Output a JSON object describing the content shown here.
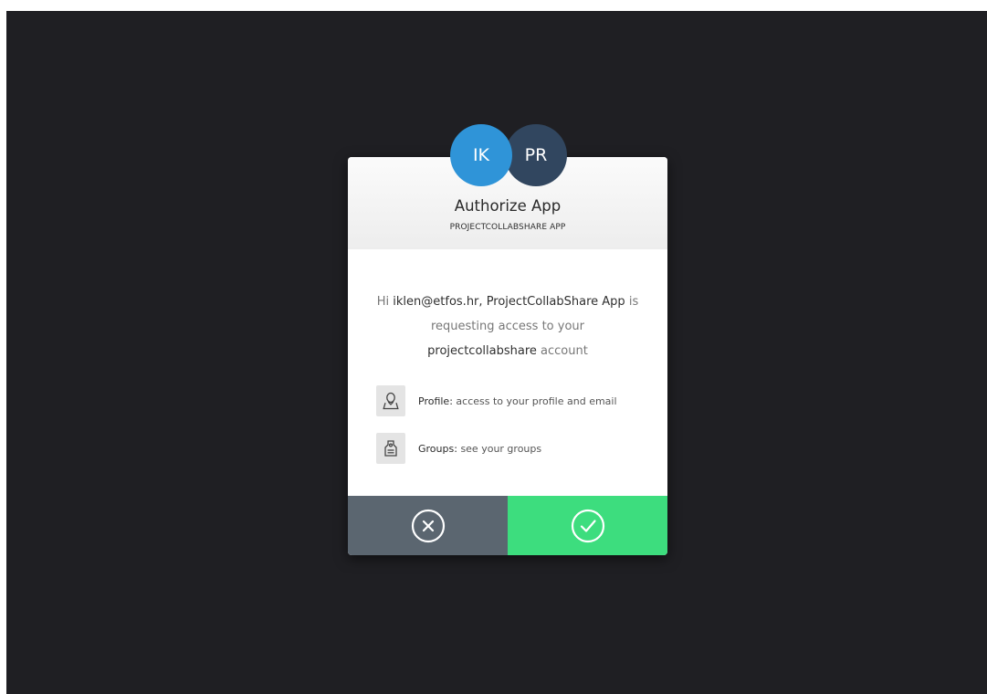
{
  "avatars": {
    "user_initials": "IK",
    "app_initials": "PR",
    "user_color": "#2f94d8",
    "app_color": "#31465f"
  },
  "header": {
    "title": "Authorize App",
    "subtitle": "PROJECTCOLLABSHARE APP"
  },
  "message": {
    "greeting": "Hi",
    "email": "iklen@etfos.hr,",
    "app_name": "ProjectCollabShare App",
    "requesting": "is requesting access to your",
    "account_name": "projectcollabshare",
    "account_suffix": "account"
  },
  "permissions": [
    {
      "label": "Profile:",
      "description": "access to your profile and email",
      "icon": "user-icon"
    },
    {
      "label": "Groups:",
      "description": "see your groups",
      "icon": "tag-icon"
    }
  ],
  "actions": {
    "deny_icon": "circle-x-icon",
    "allow_icon": "circle-check-icon",
    "deny_color": "#5b6670",
    "allow_color": "#3ddd7e"
  },
  "colors": {
    "backdrop": "#1f1f23"
  }
}
